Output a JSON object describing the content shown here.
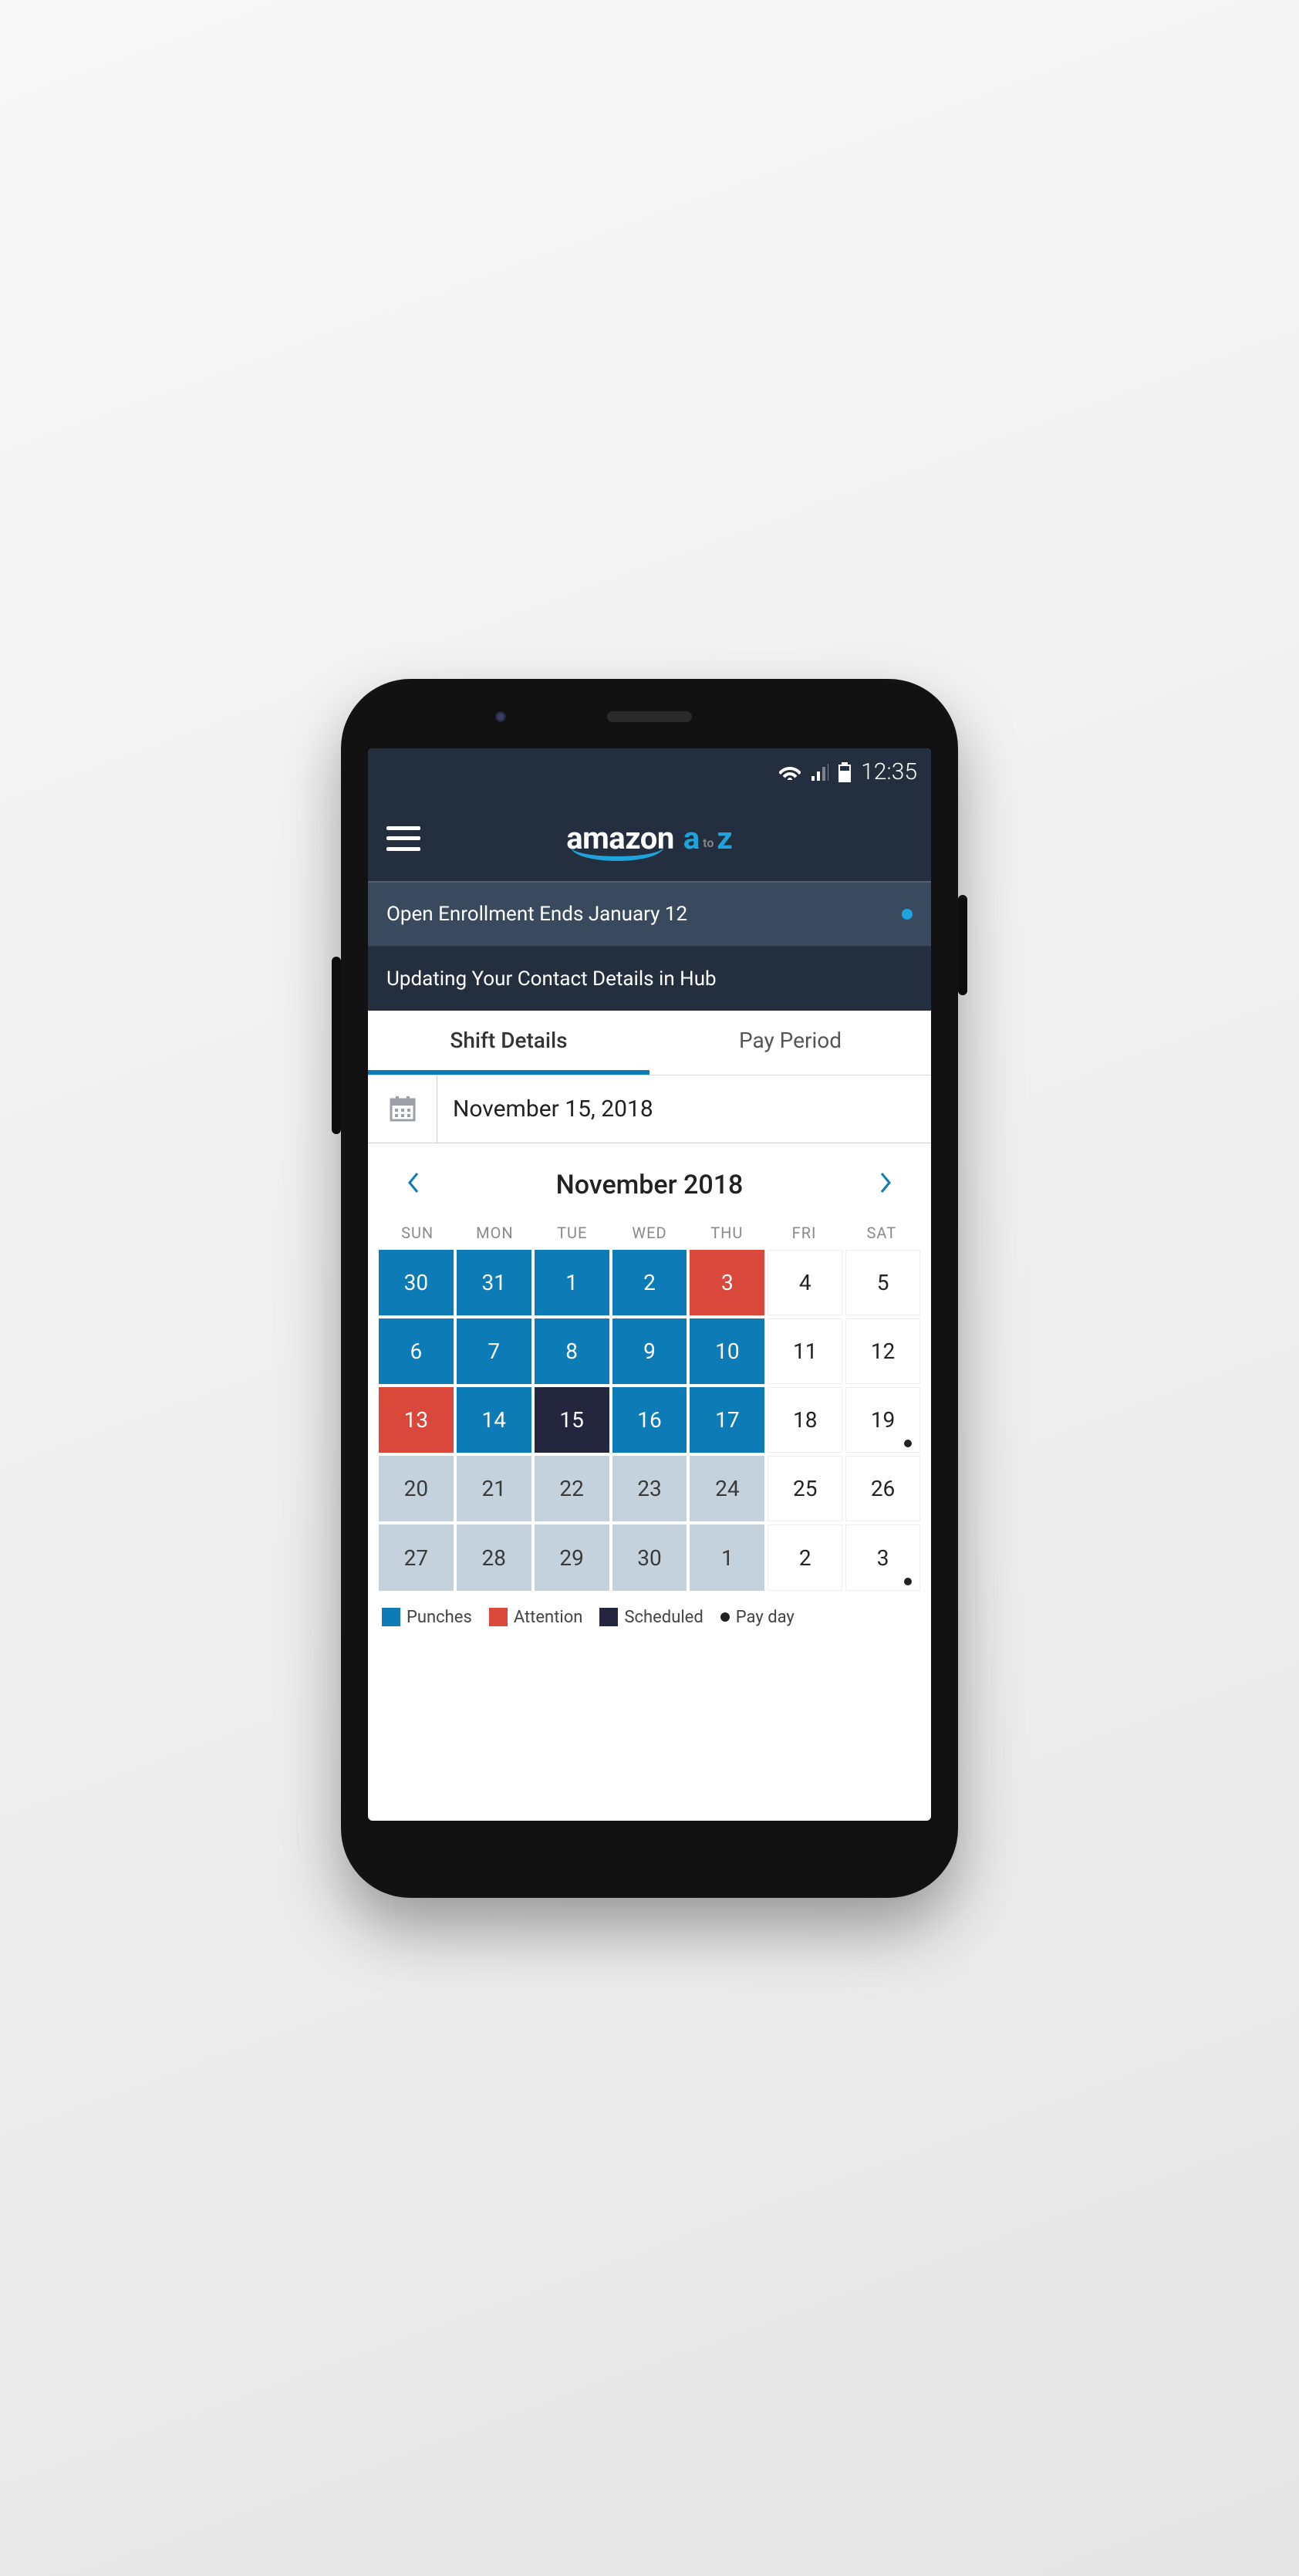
{
  "status": {
    "time": "12:35"
  },
  "header": {
    "logo_main": "amazon",
    "logo_a": "a",
    "logo_to": "to",
    "logo_z": "z"
  },
  "banners": {
    "b1": "Open Enrollment Ends January 12",
    "b2": "Updating Your Contact Details in Hub"
  },
  "tabs": {
    "shift": "Shift Details",
    "pay": "Pay Period",
    "active": "shift"
  },
  "date": {
    "display": "November 15, 2018"
  },
  "month": {
    "title": "November 2018"
  },
  "weekdays": [
    "SUN",
    "MON",
    "TUE",
    "WED",
    "THU",
    "FRI",
    "SAT"
  ],
  "legend": {
    "punches": "Punches",
    "attention": "Attention",
    "scheduled": "Scheduled",
    "payday": "Pay day"
  },
  "calendar": [
    {
      "d": "30",
      "t": "p"
    },
    {
      "d": "31",
      "t": "p"
    },
    {
      "d": "1",
      "t": "p"
    },
    {
      "d": "2",
      "t": "p"
    },
    {
      "d": "3",
      "t": "a"
    },
    {
      "d": "4",
      "t": "w"
    },
    {
      "d": "5",
      "t": "w"
    },
    {
      "d": "6",
      "t": "p"
    },
    {
      "d": "7",
      "t": "p"
    },
    {
      "d": "8",
      "t": "p"
    },
    {
      "d": "9",
      "t": "p"
    },
    {
      "d": "10",
      "t": "p"
    },
    {
      "d": "11",
      "t": "w"
    },
    {
      "d": "12",
      "t": "w"
    },
    {
      "d": "13",
      "t": "a"
    },
    {
      "d": "14",
      "t": "p"
    },
    {
      "d": "15",
      "t": "s"
    },
    {
      "d": "16",
      "t": "p"
    },
    {
      "d": "17",
      "t": "p"
    },
    {
      "d": "18",
      "t": "w"
    },
    {
      "d": "19",
      "t": "w",
      "pd": true
    },
    {
      "d": "20",
      "t": "g"
    },
    {
      "d": "21",
      "t": "g"
    },
    {
      "d": "22",
      "t": "g"
    },
    {
      "d": "23",
      "t": "g"
    },
    {
      "d": "24",
      "t": "g"
    },
    {
      "d": "25",
      "t": "w"
    },
    {
      "d": "26",
      "t": "w"
    },
    {
      "d": "27",
      "t": "g"
    },
    {
      "d": "28",
      "t": "g"
    },
    {
      "d": "29",
      "t": "g"
    },
    {
      "d": "30",
      "t": "g"
    },
    {
      "d": "1",
      "t": "g"
    },
    {
      "d": "2",
      "t": "w"
    },
    {
      "d": "3",
      "t": "w",
      "pd": true
    }
  ]
}
